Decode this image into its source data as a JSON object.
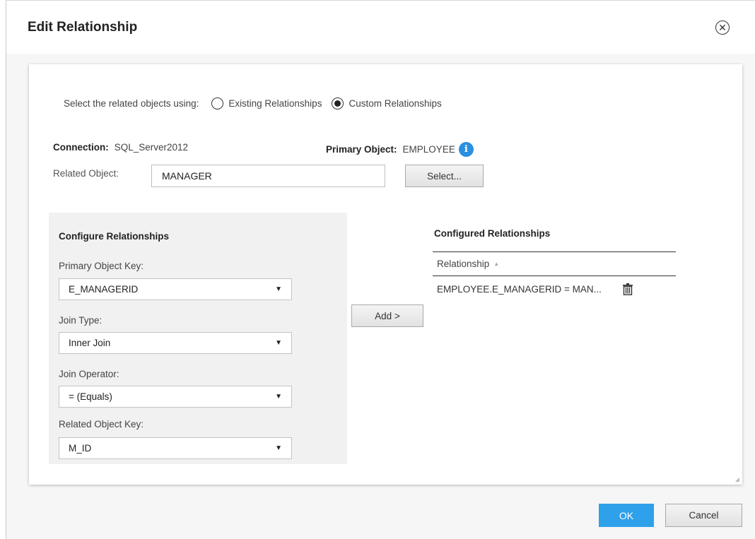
{
  "dialog": {
    "title": "Edit Relationship",
    "close_icon": "close-circle-icon"
  },
  "selection": {
    "prompt": "Select the related objects using:",
    "options": [
      {
        "label": "Existing Relationships",
        "checked": false
      },
      {
        "label": "Custom Relationships",
        "checked": true
      }
    ]
  },
  "connection": {
    "label": "Connection:",
    "value": "SQL_Server2012"
  },
  "primary_object": {
    "label": "Primary Object:",
    "value": "EMPLOYEE",
    "icon": "info-icon"
  },
  "related_object": {
    "label": "Related Object:",
    "value": "MANAGER",
    "select_label": "Select..."
  },
  "configure": {
    "title": "Configure Relationships",
    "primary_key_label": "Primary Object Key:",
    "primary_key_value": "E_MANAGERID",
    "join_type_label": "Join Type:",
    "join_type_value": "Inner Join",
    "join_operator_label": "Join Operator:",
    "join_operator_value": "= (Equals)",
    "related_key_label": "Related Object Key:",
    "related_key_value": "M_ID"
  },
  "add_label": "Add >",
  "configured": {
    "title": "Configured Relationships",
    "column": "Relationship",
    "rows": [
      {
        "relationship": "EMPLOYEE.E_MANAGERID = MAN..."
      }
    ]
  },
  "footer": {
    "ok": "OK",
    "cancel": "Cancel"
  },
  "colors": {
    "accent": "#2fa0ea",
    "info": "#2b8fe0"
  }
}
